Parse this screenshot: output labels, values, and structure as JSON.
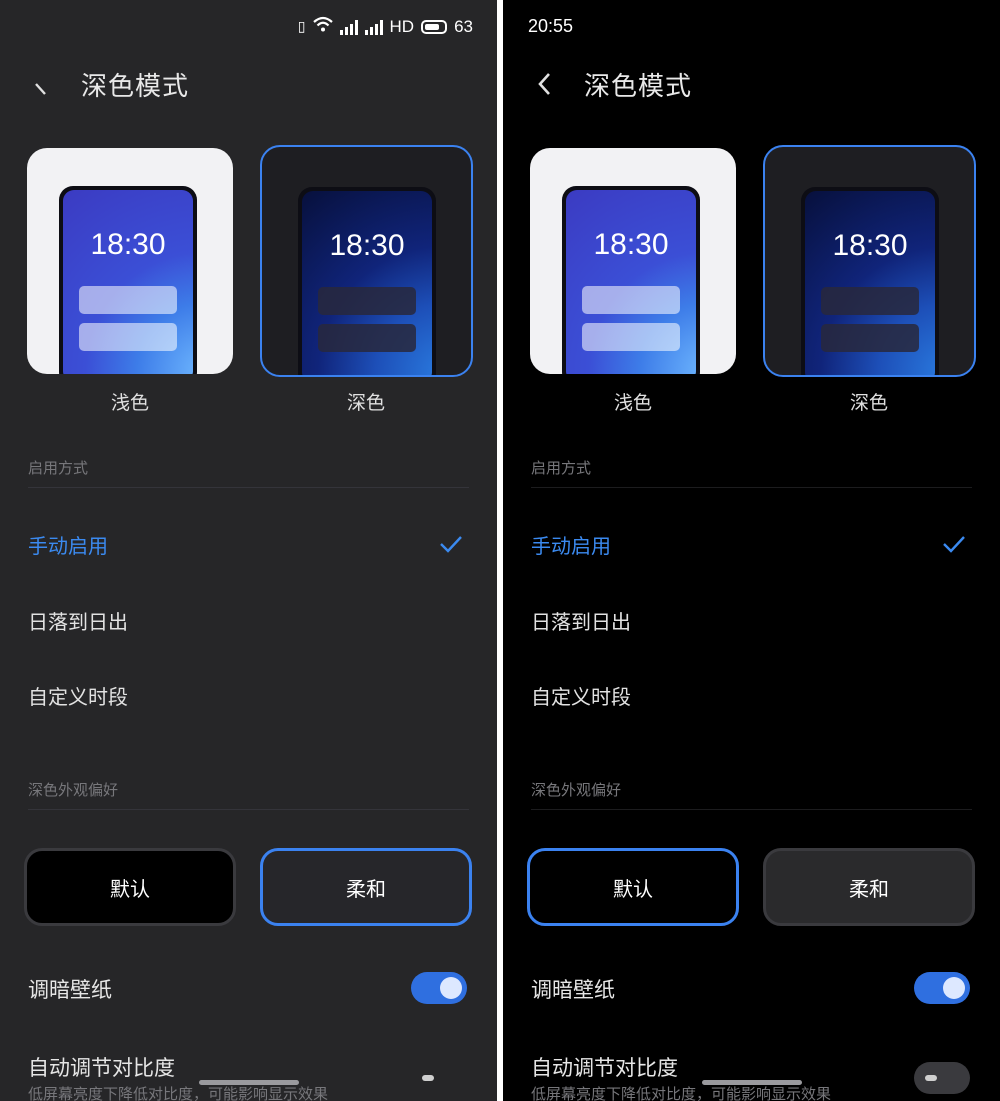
{
  "screens": [
    {
      "status": {
        "time": "",
        "network": "HD",
        "battery": "63"
      },
      "header": {
        "title": "深色模式"
      },
      "themes": [
        {
          "clock": "18:30",
          "label": "浅色"
        },
        {
          "clock": "18:30",
          "label": "深色"
        }
      ],
      "enable_mode": {
        "section": "启用方式",
        "options": [
          {
            "label": "手动启用",
            "selected": true
          },
          {
            "label": "日落到日出"
          },
          {
            "label": "自定义时段"
          }
        ]
      },
      "appearance": {
        "section": "深色外观偏好",
        "buttons": [
          {
            "label": "默认"
          },
          {
            "label": "柔和",
            "selected": true
          }
        ]
      },
      "dim_wallpaper": {
        "label": "调暗壁纸",
        "enabled": true
      },
      "auto_contrast": {
        "label": "自动调节对比度",
        "description": "低屏幕亮度下降低对比度，可能影响显示效果",
        "enabled": false
      }
    },
    {
      "status": {
        "time": "20:55",
        "network": "",
        "battery": ""
      },
      "header": {
        "title": "深色模式"
      },
      "themes": [
        {
          "clock": "18:30",
          "label": "浅色"
        },
        {
          "clock": "18:30",
          "label": "深色"
        }
      ],
      "enable_mode": {
        "section": "启用方式",
        "options": [
          {
            "label": "手动启用",
            "selected": true
          },
          {
            "label": "日落到日出"
          },
          {
            "label": "自定义时段"
          }
        ]
      },
      "appearance": {
        "section": "深色外观偏好",
        "buttons": [
          {
            "label": "默认",
            "selected": true
          },
          {
            "label": "柔和"
          }
        ]
      },
      "dim_wallpaper": {
        "label": "调暗壁纸",
        "enabled": true
      },
      "auto_contrast": {
        "label": "自动调节对比度",
        "description": "低屏幕亮度下降低对比度，可能影响显示效果",
        "enabled": false
      }
    }
  ],
  "colors": {
    "accent": "#3b82f0",
    "soft_bg": "#262628",
    "deep_bg": "#000000"
  }
}
